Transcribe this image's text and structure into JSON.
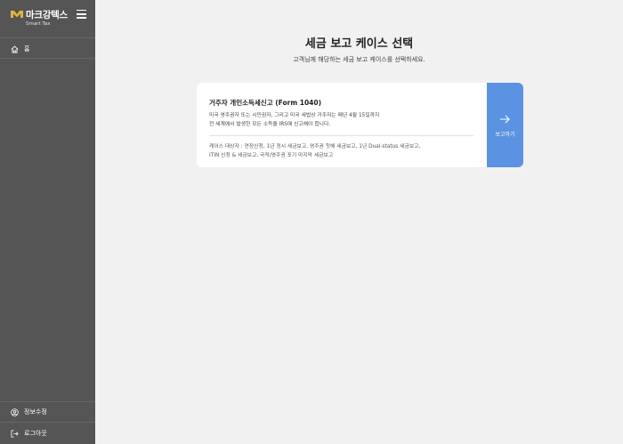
{
  "brand": {
    "name": "마크강텍스",
    "subtitle": "Smart Tax"
  },
  "sidebar": {
    "nav": [
      {
        "label": "홈",
        "icon": "home-icon"
      }
    ],
    "footer": [
      {
        "label": "정보수정",
        "icon": "user-circle-icon"
      },
      {
        "label": "로그아웃",
        "icon": "logout-icon"
      }
    ]
  },
  "main": {
    "title": "세금 보고 케이스 선택",
    "subtitle": "고객님께 해당하는 세금 보고 케이스를 선택하세요.",
    "card": {
      "title": "거주자 개인소득세신고 (Form 1040)",
      "desc_lines": [
        "미국 영주권자 또는 시민권자, 그리고 미국 세법상 거주자는 매년 4월 15일까지",
        "전 세계에서 발생한 모든 소득을 IRS에 신고해야 합니다."
      ],
      "case_lines": [
        "케이스 대상자 : 연장신청, 1년 정시 세금보고, 영주권 첫해 세금보고, 1년 Dual-status 세금보고,",
        "ITIN 신청 & 세금보고, 국적/영주권 포기 마지막 세금보고"
      ],
      "button_label": "보고하기"
    }
  },
  "colors": {
    "sidebar_bg": "#555555",
    "accent": "#5b93e2",
    "logo_gold": "#e2b33e",
    "page_bg": "#f1f1f1"
  }
}
